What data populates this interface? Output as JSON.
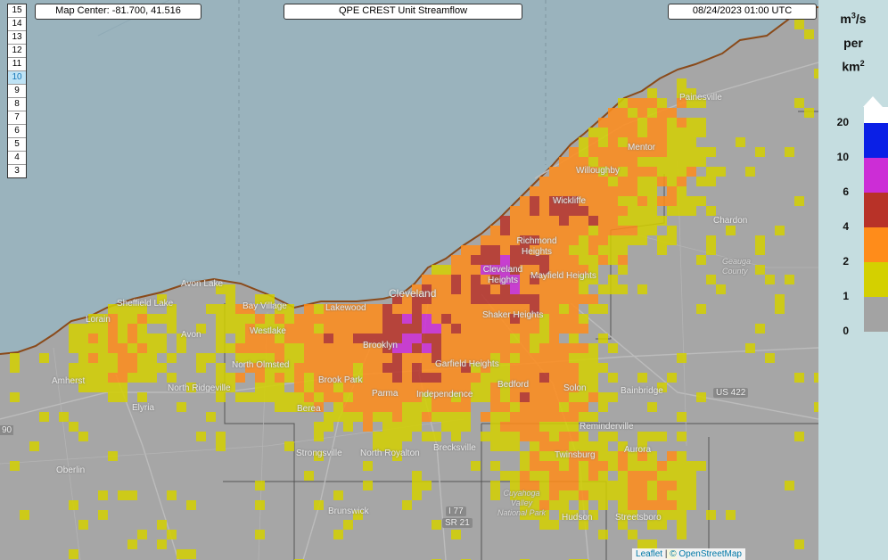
{
  "header": {
    "map_center": "Map Center: -81.700, 41.516",
    "title": "QPE CREST Unit Streamflow",
    "timestamp": "08/24/2023  01:00 UTC"
  },
  "zoom": {
    "levels": [
      "15",
      "14",
      "13",
      "12",
      "11",
      "10",
      "9",
      "8",
      "7",
      "6",
      "5",
      "4",
      "3"
    ],
    "active": "10"
  },
  "legend": {
    "unit_line1": "m3/s",
    "unit_line2": "per",
    "unit_line3": "km2",
    "ticks": [
      "20",
      "10",
      "6",
      "4",
      "2",
      "1",
      "0"
    ],
    "colors": {
      "above_20": "#ffffff",
      "10_20": "#0a1fe6",
      "6_10": "#cc2dd6",
      "4_6": "#b83228",
      "2_4": "#ff8c1a",
      "1_2": "#d4d000",
      "0_1": "#a3a3a3"
    }
  },
  "places": {
    "painesville": "Painesville",
    "mentor": "Mentor",
    "willoughby": "Willoughby",
    "wickliffe": "Wickliffe",
    "chardon": "Chardon",
    "geauga": "Geauga County",
    "richmond": "Richmond Heights",
    "cleveland_hts": "Cleveland Heights",
    "mayfield": "Mayfield Heights",
    "cleveland": "Cleveland",
    "shaker": "Shaker Heights",
    "lakewood": "Lakewood",
    "bay_village": "Bay Village",
    "westlake": "Westlake",
    "avon_lake": "Avon Lake",
    "sheffield": "Sheffield Lake",
    "lorain": "Lorain",
    "avon": "Avon",
    "north_olmsted": "North Olmsted",
    "brooklyn": "Brooklyn",
    "garfield": "Garfield Heights",
    "amherst": "Amherst",
    "north_ridgeville": "North Ridgeville",
    "brook_park": "Brook Park",
    "parma": "Parma",
    "independence": "Independence",
    "bedford": "Bedford",
    "solon": "Solon",
    "bainbridge": "Bainbridge",
    "us422": "US 422",
    "elyria": "Elyria",
    "berea": "Berea",
    "reminderville": "Reminderville",
    "strongsville": "Strongsville",
    "north_royalton": "North Royalton",
    "brecksville": "Brecksville",
    "twinsburg": "Twinsburg",
    "aurora": "Aurora",
    "oberlin": "Oberlin",
    "brunswick": "Brunswick",
    "i77": "I 77",
    "sr21": "SR 21",
    "cuyahoga": "Cuyahoga Valley National Park",
    "hudson": "Hudson",
    "streetsboro": "Streetsboro",
    "edge90": "90"
  },
  "attribution": {
    "leaflet": "Leaflet",
    "osm": "© OpenStreetMap"
  }
}
